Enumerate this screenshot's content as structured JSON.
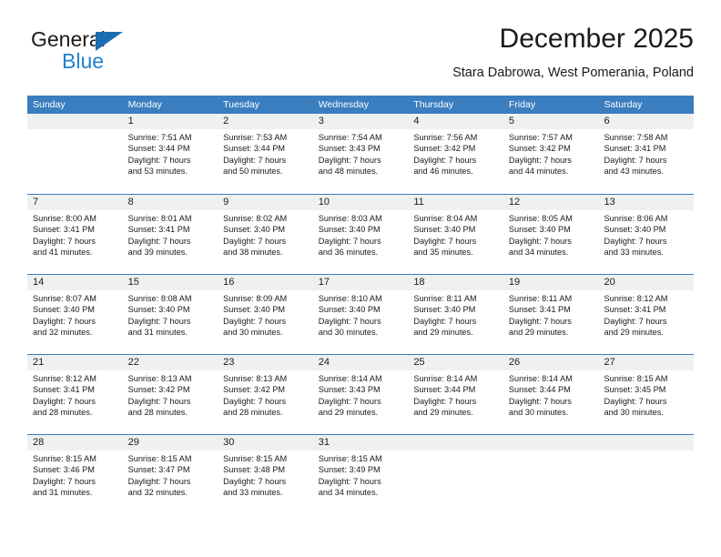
{
  "brand": {
    "line1": "General",
    "line2": "Blue",
    "triangle_color": "#1b6cb0",
    "line2_color": "#1f81d0"
  },
  "header": {
    "title": "December 2025",
    "subtitle": "Stara Dabrowa, West Pomerania, Poland"
  },
  "theme": {
    "header_blue": "#3a7ebf",
    "daynumber_band": "#f0f0f0",
    "text": "#1a1a1a"
  },
  "weekday_headers": [
    "Sunday",
    "Monday",
    "Tuesday",
    "Wednesday",
    "Thursday",
    "Friday",
    "Saturday"
  ],
  "weeks": [
    [
      {
        "day": "",
        "sunrise": "",
        "sunset": "",
        "daylight_line1": "",
        "daylight_line2": ""
      },
      {
        "day": "1",
        "sunrise": "Sunrise: 7:51 AM",
        "sunset": "Sunset: 3:44 PM",
        "daylight_line1": "Daylight: 7 hours",
        "daylight_line2": "and 53 minutes."
      },
      {
        "day": "2",
        "sunrise": "Sunrise: 7:53 AM",
        "sunset": "Sunset: 3:44 PM",
        "daylight_line1": "Daylight: 7 hours",
        "daylight_line2": "and 50 minutes."
      },
      {
        "day": "3",
        "sunrise": "Sunrise: 7:54 AM",
        "sunset": "Sunset: 3:43 PM",
        "daylight_line1": "Daylight: 7 hours",
        "daylight_line2": "and 48 minutes."
      },
      {
        "day": "4",
        "sunrise": "Sunrise: 7:56 AM",
        "sunset": "Sunset: 3:42 PM",
        "daylight_line1": "Daylight: 7 hours",
        "daylight_line2": "and 46 minutes."
      },
      {
        "day": "5",
        "sunrise": "Sunrise: 7:57 AM",
        "sunset": "Sunset: 3:42 PM",
        "daylight_line1": "Daylight: 7 hours",
        "daylight_line2": "and 44 minutes."
      },
      {
        "day": "6",
        "sunrise": "Sunrise: 7:58 AM",
        "sunset": "Sunset: 3:41 PM",
        "daylight_line1": "Daylight: 7 hours",
        "daylight_line2": "and 43 minutes."
      }
    ],
    [
      {
        "day": "7",
        "sunrise": "Sunrise: 8:00 AM",
        "sunset": "Sunset: 3:41 PM",
        "daylight_line1": "Daylight: 7 hours",
        "daylight_line2": "and 41 minutes."
      },
      {
        "day": "8",
        "sunrise": "Sunrise: 8:01 AM",
        "sunset": "Sunset: 3:41 PM",
        "daylight_line1": "Daylight: 7 hours",
        "daylight_line2": "and 39 minutes."
      },
      {
        "day": "9",
        "sunrise": "Sunrise: 8:02 AM",
        "sunset": "Sunset: 3:40 PM",
        "daylight_line1": "Daylight: 7 hours",
        "daylight_line2": "and 38 minutes."
      },
      {
        "day": "10",
        "sunrise": "Sunrise: 8:03 AM",
        "sunset": "Sunset: 3:40 PM",
        "daylight_line1": "Daylight: 7 hours",
        "daylight_line2": "and 36 minutes."
      },
      {
        "day": "11",
        "sunrise": "Sunrise: 8:04 AM",
        "sunset": "Sunset: 3:40 PM",
        "daylight_line1": "Daylight: 7 hours",
        "daylight_line2": "and 35 minutes."
      },
      {
        "day": "12",
        "sunrise": "Sunrise: 8:05 AM",
        "sunset": "Sunset: 3:40 PM",
        "daylight_line1": "Daylight: 7 hours",
        "daylight_line2": "and 34 minutes."
      },
      {
        "day": "13",
        "sunrise": "Sunrise: 8:06 AM",
        "sunset": "Sunset: 3:40 PM",
        "daylight_line1": "Daylight: 7 hours",
        "daylight_line2": "and 33 minutes."
      }
    ],
    [
      {
        "day": "14",
        "sunrise": "Sunrise: 8:07 AM",
        "sunset": "Sunset: 3:40 PM",
        "daylight_line1": "Daylight: 7 hours",
        "daylight_line2": "and 32 minutes."
      },
      {
        "day": "15",
        "sunrise": "Sunrise: 8:08 AM",
        "sunset": "Sunset: 3:40 PM",
        "daylight_line1": "Daylight: 7 hours",
        "daylight_line2": "and 31 minutes."
      },
      {
        "day": "16",
        "sunrise": "Sunrise: 8:09 AM",
        "sunset": "Sunset: 3:40 PM",
        "daylight_line1": "Daylight: 7 hours",
        "daylight_line2": "and 30 minutes."
      },
      {
        "day": "17",
        "sunrise": "Sunrise: 8:10 AM",
        "sunset": "Sunset: 3:40 PM",
        "daylight_line1": "Daylight: 7 hours",
        "daylight_line2": "and 30 minutes."
      },
      {
        "day": "18",
        "sunrise": "Sunrise: 8:11 AM",
        "sunset": "Sunset: 3:40 PM",
        "daylight_line1": "Daylight: 7 hours",
        "daylight_line2": "and 29 minutes."
      },
      {
        "day": "19",
        "sunrise": "Sunrise: 8:11 AM",
        "sunset": "Sunset: 3:41 PM",
        "daylight_line1": "Daylight: 7 hours",
        "daylight_line2": "and 29 minutes."
      },
      {
        "day": "20",
        "sunrise": "Sunrise: 8:12 AM",
        "sunset": "Sunset: 3:41 PM",
        "daylight_line1": "Daylight: 7 hours",
        "daylight_line2": "and 29 minutes."
      }
    ],
    [
      {
        "day": "21",
        "sunrise": "Sunrise: 8:12 AM",
        "sunset": "Sunset: 3:41 PM",
        "daylight_line1": "Daylight: 7 hours",
        "daylight_line2": "and 28 minutes."
      },
      {
        "day": "22",
        "sunrise": "Sunrise: 8:13 AM",
        "sunset": "Sunset: 3:42 PM",
        "daylight_line1": "Daylight: 7 hours",
        "daylight_line2": "and 28 minutes."
      },
      {
        "day": "23",
        "sunrise": "Sunrise: 8:13 AM",
        "sunset": "Sunset: 3:42 PM",
        "daylight_line1": "Daylight: 7 hours",
        "daylight_line2": "and 28 minutes."
      },
      {
        "day": "24",
        "sunrise": "Sunrise: 8:14 AM",
        "sunset": "Sunset: 3:43 PM",
        "daylight_line1": "Daylight: 7 hours",
        "daylight_line2": "and 29 minutes."
      },
      {
        "day": "25",
        "sunrise": "Sunrise: 8:14 AM",
        "sunset": "Sunset: 3:44 PM",
        "daylight_line1": "Daylight: 7 hours",
        "daylight_line2": "and 29 minutes."
      },
      {
        "day": "26",
        "sunrise": "Sunrise: 8:14 AM",
        "sunset": "Sunset: 3:44 PM",
        "daylight_line1": "Daylight: 7 hours",
        "daylight_line2": "and 30 minutes."
      },
      {
        "day": "27",
        "sunrise": "Sunrise: 8:15 AM",
        "sunset": "Sunset: 3:45 PM",
        "daylight_line1": "Daylight: 7 hours",
        "daylight_line2": "and 30 minutes."
      }
    ],
    [
      {
        "day": "28",
        "sunrise": "Sunrise: 8:15 AM",
        "sunset": "Sunset: 3:46 PM",
        "daylight_line1": "Daylight: 7 hours",
        "daylight_line2": "and 31 minutes."
      },
      {
        "day": "29",
        "sunrise": "Sunrise: 8:15 AM",
        "sunset": "Sunset: 3:47 PM",
        "daylight_line1": "Daylight: 7 hours",
        "daylight_line2": "and 32 minutes."
      },
      {
        "day": "30",
        "sunrise": "Sunrise: 8:15 AM",
        "sunset": "Sunset: 3:48 PM",
        "daylight_line1": "Daylight: 7 hours",
        "daylight_line2": "and 33 minutes."
      },
      {
        "day": "31",
        "sunrise": "Sunrise: 8:15 AM",
        "sunset": "Sunset: 3:49 PM",
        "daylight_line1": "Daylight: 7 hours",
        "daylight_line2": "and 34 minutes."
      },
      {
        "day": "",
        "sunrise": "",
        "sunset": "",
        "daylight_line1": "",
        "daylight_line2": ""
      },
      {
        "day": "",
        "sunrise": "",
        "sunset": "",
        "daylight_line1": "",
        "daylight_line2": ""
      },
      {
        "day": "",
        "sunrise": "",
        "sunset": "",
        "daylight_line1": "",
        "daylight_line2": ""
      }
    ]
  ]
}
